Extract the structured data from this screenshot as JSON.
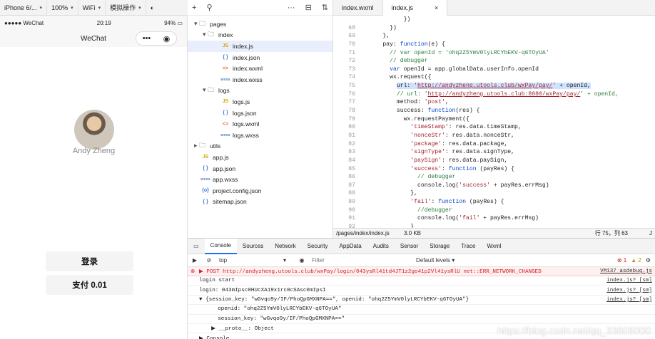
{
  "toolbar": {
    "device": "iPhone 6/...",
    "zoom": "100%",
    "network": "WiFi",
    "mode": "模拟操作"
  },
  "phone": {
    "carrier": "●●●●● WeChat",
    "time": "20:19",
    "battery": "94%",
    "nav_title": "WeChat",
    "nickname": "Andy Zheng",
    "login_button": "登录",
    "pay_button": "支付 0.01"
  },
  "filetree": {
    "rows": [
      {
        "depth": 1,
        "type": "folder-open",
        "name": "pages"
      },
      {
        "depth": 2,
        "type": "folder-open",
        "name": "index"
      },
      {
        "depth": 3,
        "type": "js",
        "name": "index.js",
        "selected": true
      },
      {
        "depth": 3,
        "type": "json",
        "name": "index.json"
      },
      {
        "depth": 3,
        "type": "wxml",
        "name": "index.wxml"
      },
      {
        "depth": 3,
        "type": "wxss",
        "name": "index.wxss"
      },
      {
        "depth": 2,
        "type": "folder-open",
        "name": "logs"
      },
      {
        "depth": 3,
        "type": "js",
        "name": "logs.js"
      },
      {
        "depth": 3,
        "type": "json",
        "name": "logs.json"
      },
      {
        "depth": 3,
        "type": "wxml",
        "name": "logs.wxml"
      },
      {
        "depth": 3,
        "type": "wxss",
        "name": "logs.wxss"
      },
      {
        "depth": 1,
        "type": "folder-closed",
        "name": "utils"
      },
      {
        "depth": 1,
        "type": "js",
        "name": "app.js"
      },
      {
        "depth": 1,
        "type": "json",
        "name": "app.json"
      },
      {
        "depth": 1,
        "type": "wxss",
        "name": "app.wxss"
      },
      {
        "depth": 1,
        "type": "config",
        "name": "project.config.json"
      },
      {
        "depth": 1,
        "type": "json",
        "name": "sitemap.json"
      }
    ]
  },
  "tabs": [
    "index.wxml",
    "index.js"
  ],
  "code_lines": [
    {
      "n": "",
      "html": "          })"
    },
    {
      "n": "68",
      "html": "      })"
    },
    {
      "n": "69",
      "html": "    },"
    },
    {
      "n": "70",
      "html": "    pay: <span class=\"kw\">function</span>(e) {"
    },
    {
      "n": "71",
      "html": "      <span class=\"cm\">// var openId = 'ohq2Z5YmV0lyLRCYbEKV-q6TOyUA'</span>"
    },
    {
      "n": "72",
      "html": "      <span class=\"cm\">// debugger</span>"
    },
    {
      "n": "73",
      "html": "      <span class=\"kw\">var</span> openId = app.globalData.userInfo.openId"
    },
    {
      "n": "74",
      "html": "      wx.request({"
    },
    {
      "n": "75",
      "html": "        <span class=\"hl\">url: <span class=\"str\">'<span class=\"url\">http://andyzheng.utools.club/wxPay/pay/</span>'</span> + openId,</span>"
    },
    {
      "n": "76",
      "html": "        <span class=\"cm\">// url: '<span class=\"url\">http://andyzheng.utools.club:8080/wxPay/pay/</span>' + openId,</span>"
    },
    {
      "n": "77",
      "html": "        method: <span class=\"str\">'post'</span>,"
    },
    {
      "n": "78",
      "html": "        success: <span class=\"kw\">function</span>(res) {"
    },
    {
      "n": "79",
      "html": "          wx.requestPayment({"
    },
    {
      "n": "80",
      "html": "            <span class=\"str\">'timeStamp'</span>: res.data.timeStamp,"
    },
    {
      "n": "81",
      "html": "            <span class=\"str\">'nonceStr'</span>: res.data.nonceStr,"
    },
    {
      "n": "82",
      "html": "            <span class=\"str\">'package'</span>: res.data.package,"
    },
    {
      "n": "83",
      "html": "            <span class=\"str\">'signType'</span>: res.data.signType,"
    },
    {
      "n": "84",
      "html": "            <span class=\"str\">'paySign'</span>: res.data.paySign,"
    },
    {
      "n": "85",
      "html": "            <span class=\"str\">'success'</span>: <span class=\"kw\">function</span> (payRes) {"
    },
    {
      "n": "86",
      "html": "              <span class=\"cm\">// debugger</span>"
    },
    {
      "n": "87",
      "html": "              console.log(<span class=\"str\">'success'</span> + payRes.errMsg)"
    },
    {
      "n": "88",
      "html": "            },"
    },
    {
      "n": "89",
      "html": "            <span class=\"str\">'fail'</span>: <span class=\"kw\">function</span> (payRes) {"
    },
    {
      "n": "90",
      "html": "              <span class=\"cm\">//debugger</span>"
    },
    {
      "n": "91",
      "html": "              console.log(<span class=\"str\">'fail'</span> + payRes.errMsg)"
    },
    {
      "n": "92",
      "html": "            }"
    }
  ],
  "editor_status": {
    "path": "/pages/index/index.js",
    "size": "3.0 KB",
    "position": "行 75，列 63",
    "lang": "J"
  },
  "devtools": {
    "tabs": [
      "Console",
      "Sources",
      "Network",
      "Security",
      "AppData",
      "Audits",
      "Sensor",
      "Storage",
      "Trace",
      "Wxml"
    ],
    "context": "top",
    "filter_placeholder": "Filter",
    "levels": "Default levels ▾",
    "error_count": "1",
    "warn_count": "2",
    "rows": [
      {
        "type": "error",
        "text": "▶ POST http://andyzheng.utools.club/wxPay/login/043ysRl41td4JT1z2go41p2Vl41ysRlU net::ERR_NETWORK_CHANGED",
        "src": "VM137 asdebug.js"
      },
      {
        "type": "log",
        "text": "login start",
        "src": "index.js? [sm]"
      },
      {
        "type": "log",
        "text": "login: 043mIpsc0HUcXA19x1rc0cSAsc0mIpsI",
        "src": "index.js? [sm]"
      },
      {
        "type": "log",
        "text": "▼ {session_key: \"wGvqo9y/IF/PhoQpGMXNPA==\", openid: \"ohq2Z5YmV0lyLRCYbEKV-q6TOyUA\"}",
        "src": "index.js? [sm]"
      },
      {
        "type": "sub",
        "text": "    openid: \"ohq2Z5YmV0lyLRCYbEKV-q6TOyUA\"",
        "src": ""
      },
      {
        "type": "sub",
        "text": "    session_key: \"wGvqo9y/IF/PhoQpGMXNPA==\"",
        "src": ""
      },
      {
        "type": "sub",
        "text": "  ▶ __proto__: Object",
        "src": ""
      },
      {
        "type": "log",
        "text": "▶ Console",
        "src": ""
      }
    ]
  },
  "watermark": "https://blog.csdn.net/qq_33608000"
}
